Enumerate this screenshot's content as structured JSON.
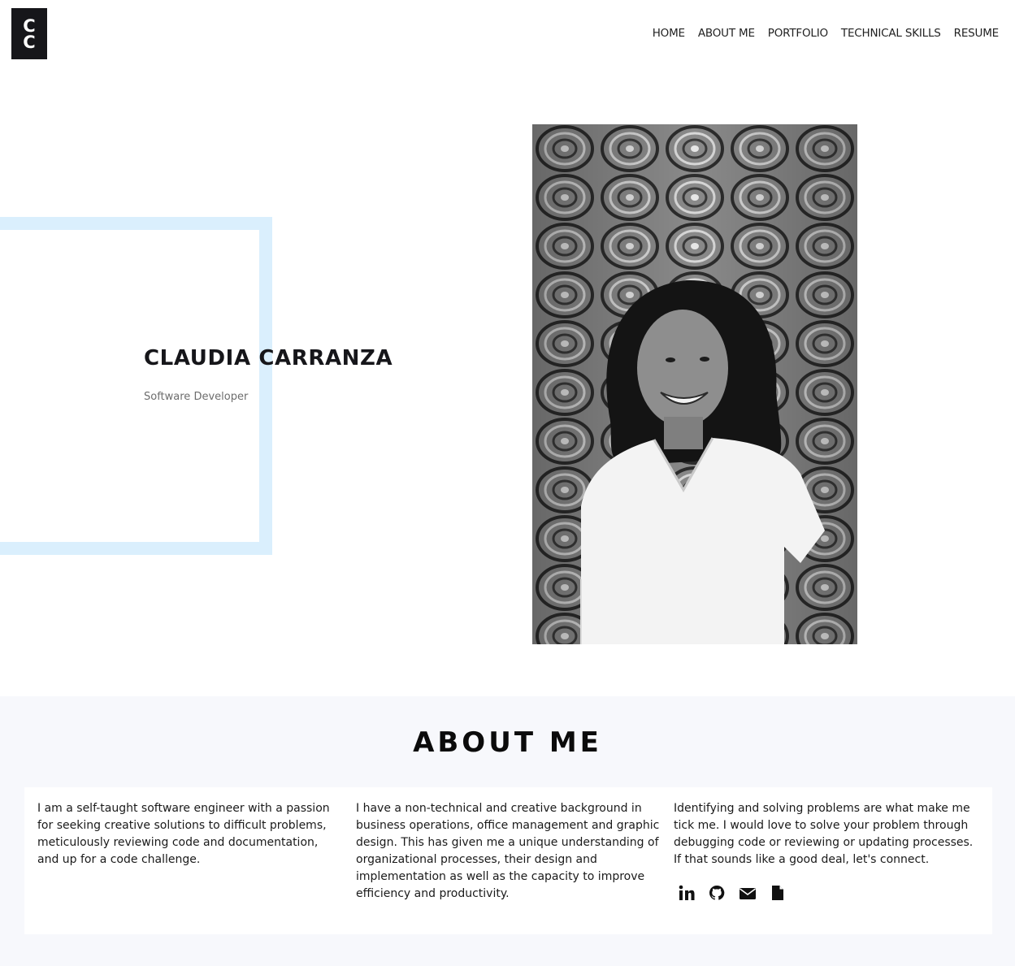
{
  "header": {
    "logo_line1": "C",
    "logo_line2": "C",
    "nav": [
      "HOME",
      "ABOUT ME",
      "PORTFOLIO",
      "TECHNICAL SKILLS",
      "RESUME"
    ]
  },
  "hero": {
    "name": "CLAUDIA CARRANZA",
    "role": "Software Developer",
    "frame_color": "#daeffd",
    "photo_desc": "black-and-white portrait photo"
  },
  "about": {
    "title": "ABOUT ME",
    "paragraphs": [
      "I am a self-taught software engineer with a passion for seeking creative solutions to difficult problems, meticulously reviewing code and documentation, and up for a code challenge.",
      "I have a non-technical and creative background in business operations, office management and graphic design. This has given me a unique understanding of organizational processes, their design and implementation as well as the capacity to improve efficiency and productivity.",
      "Identifying and solving problems are what make me tick me. I would love to solve your problem through debugging code or reviewing or updating processes. If that sounds like a good deal, let's connect."
    ],
    "social_icons": [
      "linkedin-icon",
      "github-icon",
      "envelope-icon",
      "file-icon"
    ]
  }
}
